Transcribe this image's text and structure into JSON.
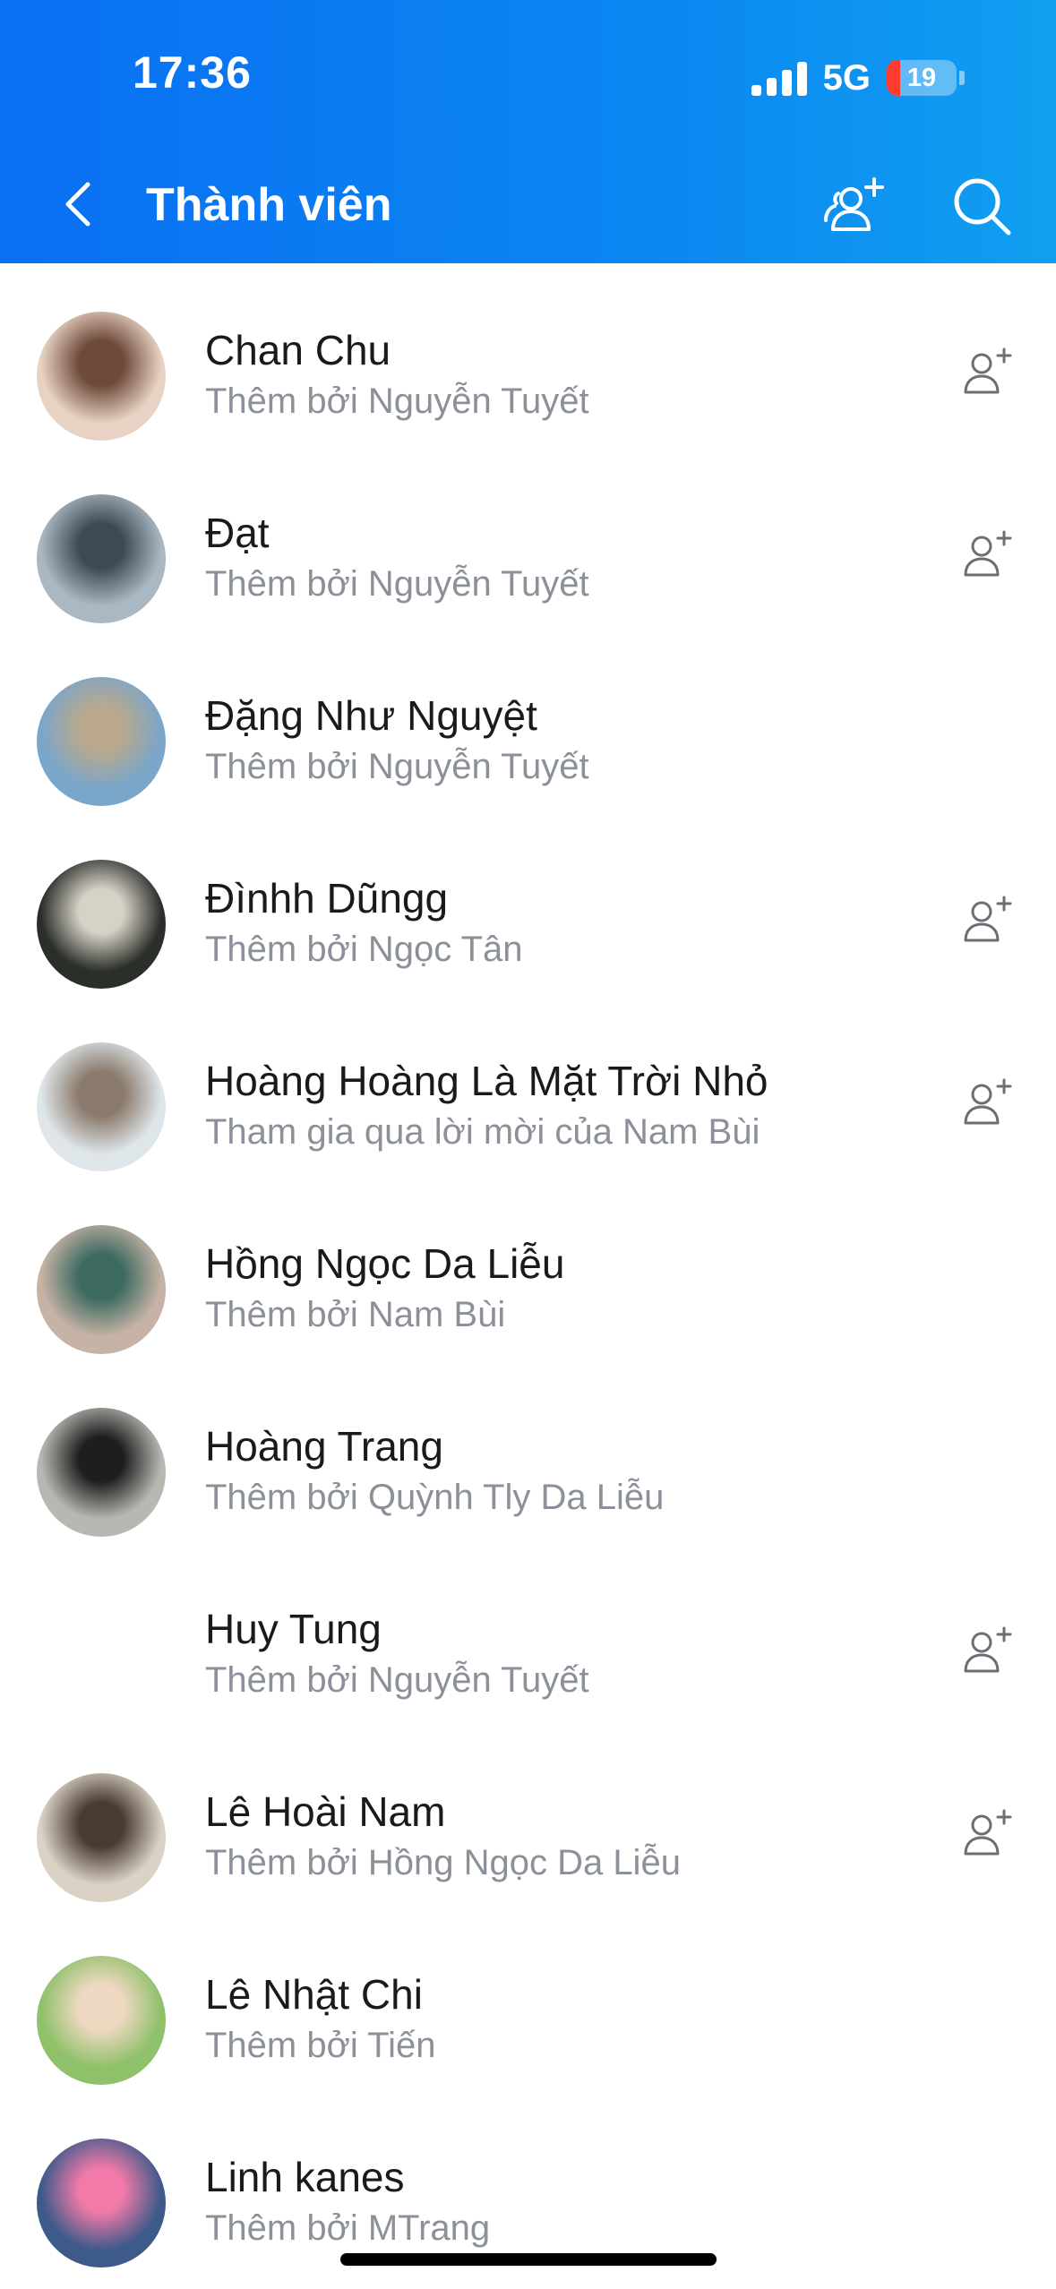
{
  "status_bar": {
    "time": "17:36",
    "network": "5G",
    "battery": "19",
    "battery_fraction": 0.19
  },
  "header": {
    "title": "Thành viên",
    "back_icon": "chevron-left-icon",
    "add_member_icon": "add-users-icon",
    "search_icon": "search-icon"
  },
  "members": [
    {
      "name": "Chan Chu",
      "sub": "Thêm bởi Nguyễn Tuyết",
      "add_friend": true,
      "avatar": "selfie",
      "avatar_colors": [
        "#e8d2c4",
        "#6d4a3a"
      ]
    },
    {
      "name": "Đạt",
      "sub": "Thêm bởi Nguyễn Tuyết",
      "add_friend": true,
      "avatar": "pier",
      "avatar_colors": [
        "#aab8c4",
        "#3e4a52"
      ]
    },
    {
      "name": "Đặng Như Nguyệt",
      "sub": "Thêm bởi Nguyễn Tuyết",
      "add_friend": false,
      "avatar": "beach",
      "avatar_colors": [
        "#7aa6c9",
        "#b9a88d"
      ]
    },
    {
      "name": "Đìnhh Dũngg",
      "sub": "Thêm bởi Ngọc Tân",
      "add_friend": true,
      "avatar": "dark",
      "avatar_colors": [
        "#2b2f2a",
        "#d7d2c7"
      ]
    },
    {
      "name": "Hoàng Hoàng Là Mặt Trời Nhỏ",
      "sub": "Tham gia qua lời mời của Nam Bùi",
      "add_friend": true,
      "avatar": "otter",
      "avatar_colors": [
        "#dfe6ea",
        "#8a7a6b"
      ]
    },
    {
      "name": "Hồng Ngọc Da Liễu",
      "sub": "Thêm bởi Nam Bùi",
      "add_friend": false,
      "avatar": "clinic",
      "avatar_colors": [
        "#c7b3a6",
        "#3c6a60"
      ]
    },
    {
      "name": "Hoàng Trang",
      "sub": "Thêm bởi Quỳnh Tly Da Liễu",
      "add_friend": false,
      "avatar": "station",
      "avatar_colors": [
        "#b9b7b2",
        "#1e1e1e"
      ]
    },
    {
      "name": "Huy Tung",
      "sub": "Thêm bởi Nguyễn Tuyết",
      "add_friend": true,
      "avatar": "none",
      "avatar_colors": [
        "#ffffff",
        "#ffffff"
      ]
    },
    {
      "name": "Lê Hoài Nam",
      "sub": "Thêm bởi Hồng Ngọc Da Liễu",
      "add_friend": true,
      "avatar": "mirror",
      "avatar_colors": [
        "#d9d2c5",
        "#4a3b30"
      ]
    },
    {
      "name": "Lê Nhật Chi",
      "sub": "Thêm bởi Tiến",
      "add_friend": false,
      "avatar": "hat",
      "avatar_colors": [
        "#8fc06a",
        "#f0d9c2"
      ]
    },
    {
      "name": "Linh kanes",
      "sub": "Thêm bởi MTrang",
      "add_friend": false,
      "avatar": "pink",
      "avatar_colors": [
        "#3d5a8a",
        "#f27aa8"
      ]
    }
  ],
  "colors": {
    "header_start": "#0a6ff2",
    "header_end": "#109ff0",
    "name_text": "#1a1a1a",
    "sub_text": "#8b9099",
    "icon_gray": "#6b6f75"
  }
}
